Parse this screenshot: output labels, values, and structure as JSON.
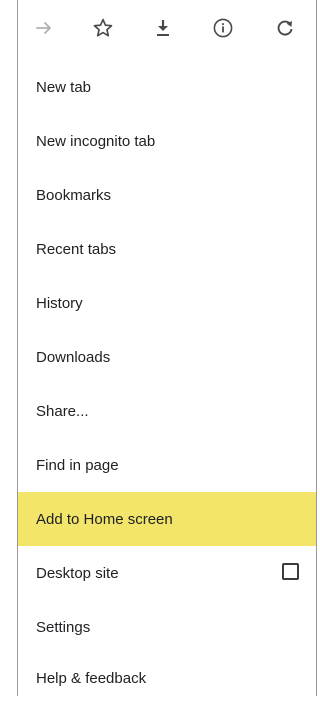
{
  "toolbar": {
    "icons": [
      "forward-arrow-icon",
      "bookmark-star-icon",
      "download-icon",
      "info-icon",
      "reload-icon"
    ]
  },
  "menu": {
    "items": [
      {
        "label": "New tab"
      },
      {
        "label": "New incognito tab"
      },
      {
        "label": "Bookmarks"
      },
      {
        "label": "Recent tabs"
      },
      {
        "label": "History"
      },
      {
        "label": "Downloads"
      },
      {
        "label": "Share..."
      },
      {
        "label": "Find in page"
      },
      {
        "label": "Add to Home screen",
        "highlighted": true
      },
      {
        "label": "Desktop site",
        "checkbox": false
      },
      {
        "label": "Settings"
      },
      {
        "label": "Help & feedback"
      }
    ]
  },
  "colors": {
    "highlight": "#f3e46a",
    "icon": "#4a4a4a",
    "icon_disabled": "#b0b0b0"
  }
}
